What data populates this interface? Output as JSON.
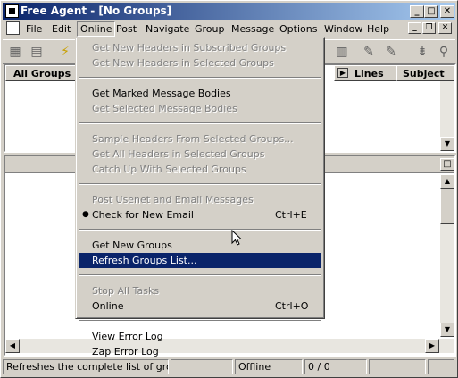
{
  "window": {
    "title": "Free Agent - [No Groups]"
  },
  "caption_buttons": {
    "minimize": "_",
    "maximize": "□",
    "close": "✕"
  },
  "mdi_buttons": {
    "minimize": "_",
    "restore": "❐",
    "close": "✕"
  },
  "menubar": {
    "items": [
      "File",
      "Edit",
      "Online",
      "Post",
      "Navigate",
      "Group",
      "Message",
      "Options",
      "Window",
      "Help"
    ],
    "active": "Online"
  },
  "groups_pane": {
    "header": "All Groups"
  },
  "headers_pane": {
    "columns": [
      "Lines",
      "Subject"
    ]
  },
  "online_menu": {
    "items": [
      {
        "label": "Get New Headers in Subscribed Groups",
        "enabled": false
      },
      {
        "label": "Get New Headers in Selected Groups",
        "enabled": false
      },
      {
        "separator": true
      },
      {
        "label": "Get Marked Message Bodies",
        "enabled": true
      },
      {
        "label": "Get Selected Message Bodies",
        "enabled": false
      },
      {
        "separator": true
      },
      {
        "label": "Sample Headers From Selected Groups...",
        "enabled": false
      },
      {
        "label": "Get All Headers in Selected Groups",
        "enabled": false
      },
      {
        "label": "Catch Up With Selected Groups",
        "enabled": false
      },
      {
        "separator": true
      },
      {
        "label": "Post Usenet and Email Messages",
        "enabled": false
      },
      {
        "label": "Check for New Email",
        "enabled": true,
        "checked": true,
        "shortcut": "Ctrl+E"
      },
      {
        "separator": true
      },
      {
        "label": "Get New Groups",
        "enabled": true
      },
      {
        "label": "Refresh Groups List...",
        "enabled": true,
        "highlighted": true
      },
      {
        "separator": true
      },
      {
        "label": "Stop All Tasks",
        "enabled": false
      },
      {
        "label": "Online",
        "enabled": true,
        "shortcut": "Ctrl+O"
      },
      {
        "separator": true
      },
      {
        "label": "View Error Log",
        "enabled": true
      },
      {
        "label": "Zap Error Log",
        "enabled": true
      }
    ]
  },
  "statusbar": {
    "message": "Refreshes the complete list of groups",
    "connection": "Offline",
    "counter": "0 / 0"
  },
  "colors": {
    "title_start": "#0a246a",
    "title_end": "#a6caf0",
    "highlight": "#0a246a",
    "face": "#d4d0c8"
  }
}
